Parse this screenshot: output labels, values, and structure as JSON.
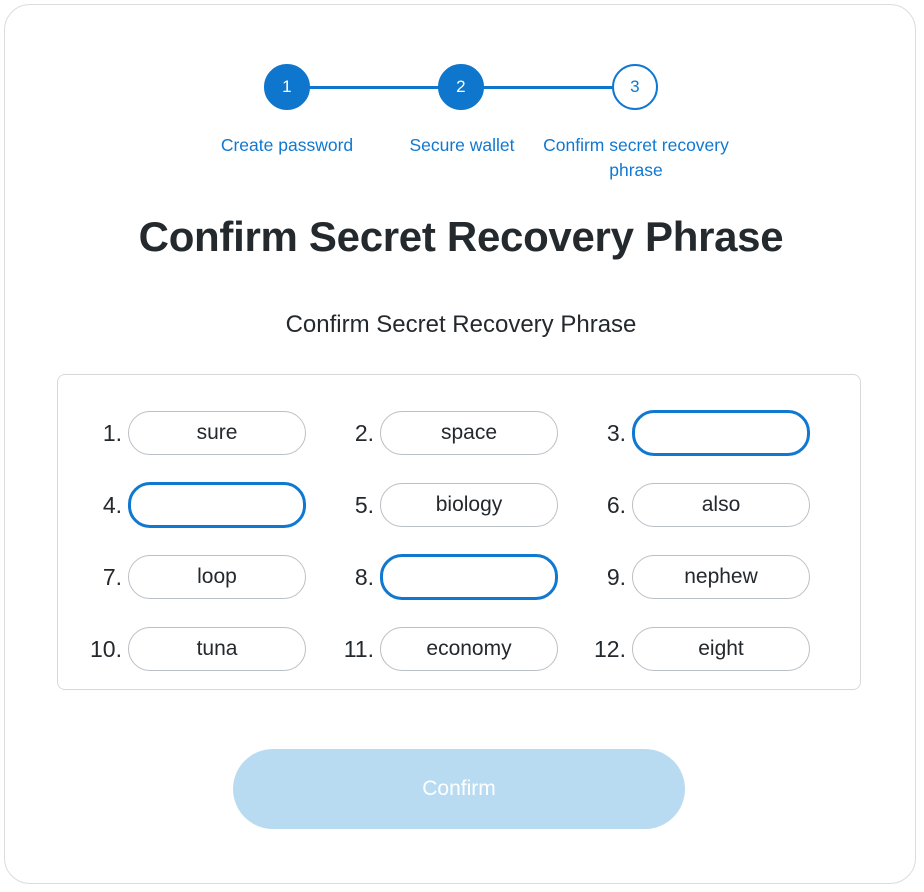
{
  "colors": {
    "accent": "#0e76cc",
    "accent_light": "#1078d0",
    "text": "#24292e",
    "border": "#d6d9dc",
    "button_disabled": "#b8dbf2"
  },
  "stepper": {
    "steps": [
      {
        "number": "1",
        "label": "Create password",
        "state": "done"
      },
      {
        "number": "2",
        "label": "Secure wallet",
        "state": "done"
      },
      {
        "number": "3",
        "label": "Confirm secret recovery phrase",
        "state": "current"
      }
    ]
  },
  "header": {
    "title": "Confirm Secret Recovery Phrase",
    "subtitle": "Confirm Secret Recovery Phrase"
  },
  "word_grid": {
    "words": [
      {
        "index": "1.",
        "value": "sure",
        "state": "filled"
      },
      {
        "index": "2.",
        "value": "space",
        "state": "filled"
      },
      {
        "index": "3.",
        "value": "",
        "state": "empty"
      },
      {
        "index": "4.",
        "value": "",
        "state": "empty"
      },
      {
        "index": "5.",
        "value": "biology",
        "state": "filled"
      },
      {
        "index": "6.",
        "value": "also",
        "state": "filled"
      },
      {
        "index": "7.",
        "value": "loop",
        "state": "filled"
      },
      {
        "index": "8.",
        "value": "",
        "state": "empty"
      },
      {
        "index": "9.",
        "value": "nephew",
        "state": "filled"
      },
      {
        "index": "10.",
        "value": "tuna",
        "state": "filled"
      },
      {
        "index": "11.",
        "value": "economy",
        "state": "filled"
      },
      {
        "index": "12.",
        "value": "eight",
        "state": "filled"
      }
    ]
  },
  "footer": {
    "confirm_label": "Confirm"
  }
}
